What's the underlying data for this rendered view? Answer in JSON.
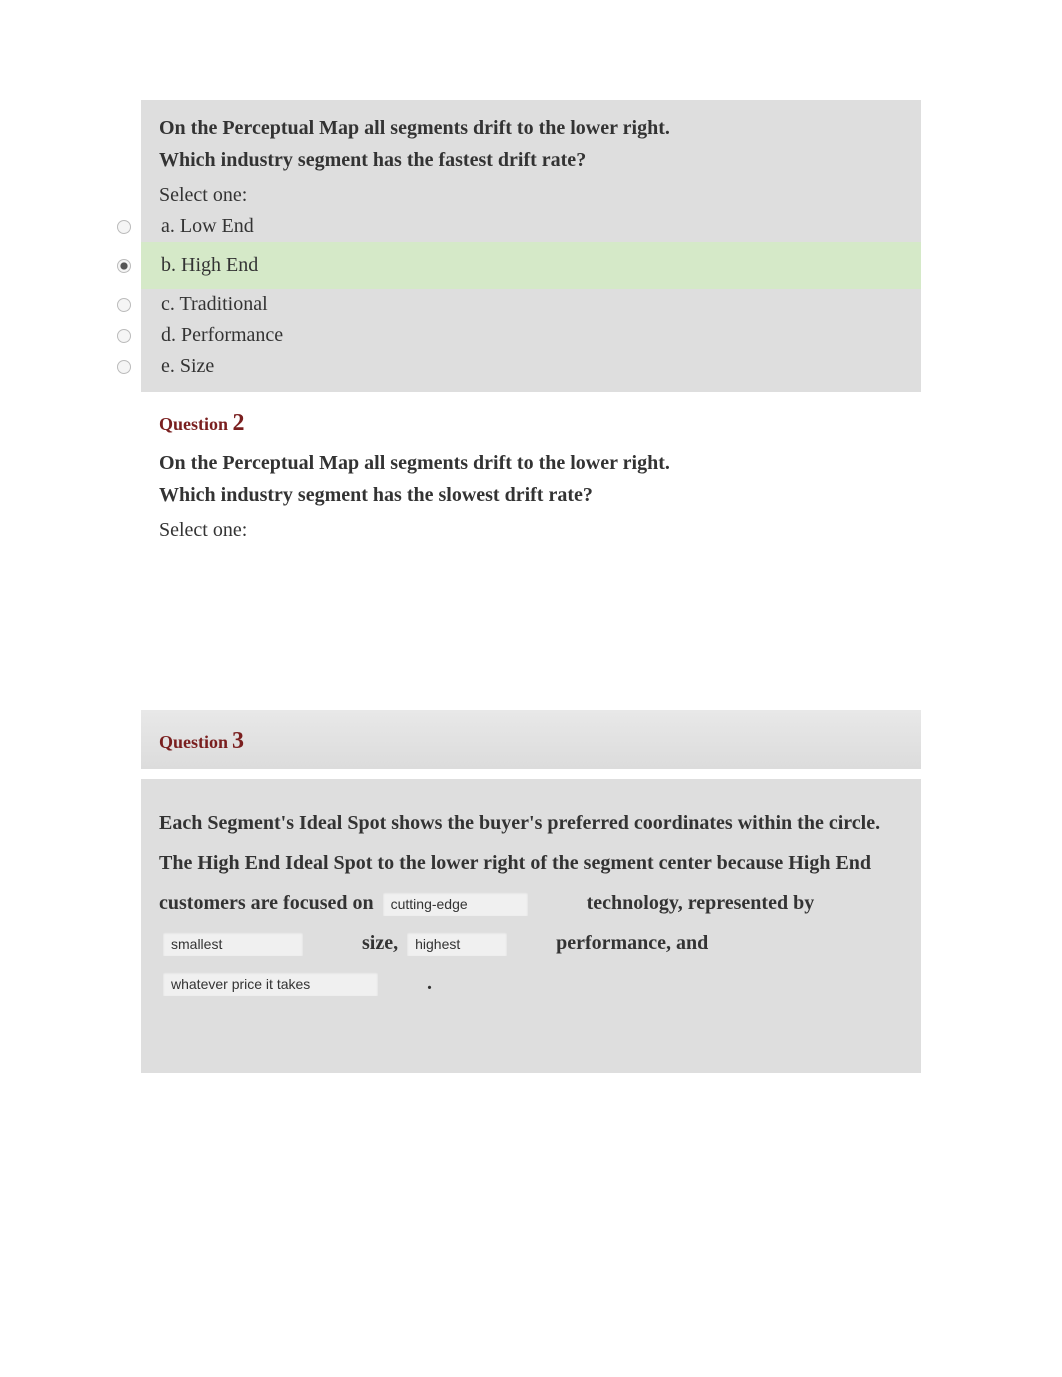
{
  "q1": {
    "prompt_line1": "On the Perceptual Map all segments drift to the lower right.",
    "prompt_line2": "Which industry segment has the fastest drift rate?",
    "select_one": "Select one:",
    "options": {
      "a": "a. Low End",
      "b": "b. High End",
      "c": "c. Traditional",
      "d": "d. Performance",
      "e": "e. Size"
    }
  },
  "q2": {
    "header_word": "Question",
    "header_num": "2",
    "prompt_line1": "On the Perceptual Map all segments drift to the lower right.",
    "prompt_line2": "Which industry segment has the slowest drift rate?",
    "select_one": "Select one:"
  },
  "q3": {
    "header_word": "Question",
    "header_num": "3",
    "text_parts": {
      "p1": "Each Segment's Ideal Spot shows the buyer's preferred coordinates within the circle. The High End Ideal Spot to the lower right of the segment center because High End customers are focused on",
      "p2": "technology, represented by",
      "p3": "size,",
      "p4": "performance, and",
      "p5": "."
    },
    "inputs": {
      "i1": "cutting-edge",
      "i2": "smallest",
      "i3": "highest",
      "i4": "whatever price it takes"
    }
  }
}
